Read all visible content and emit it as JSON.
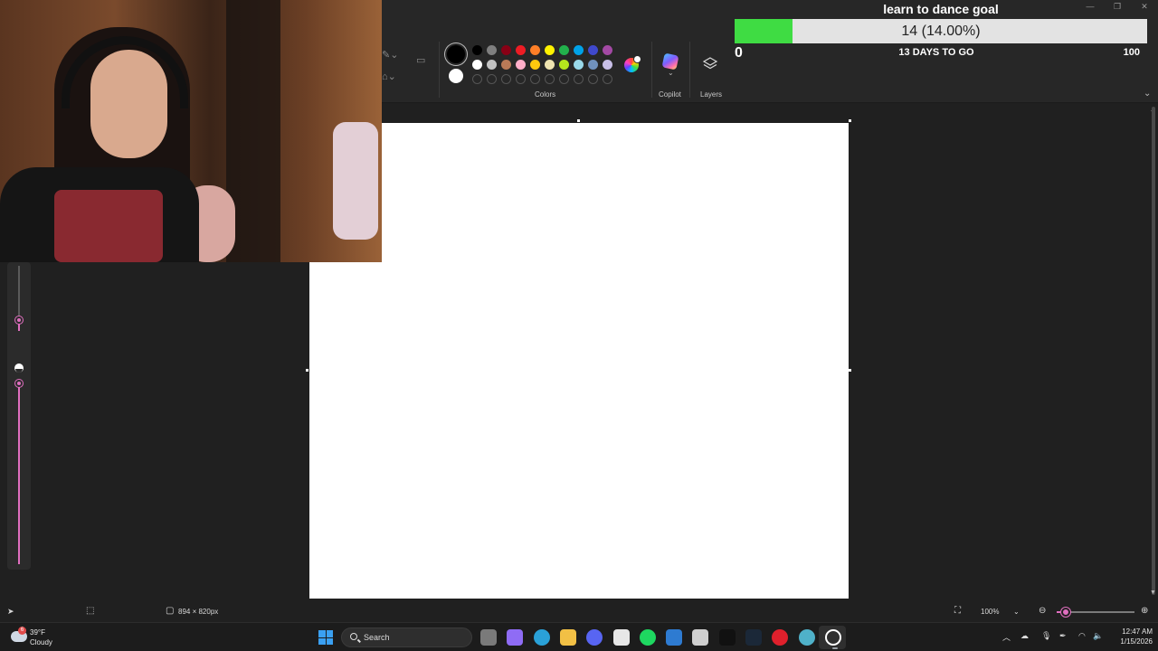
{
  "paint": {
    "ribbon": {
      "colors_label": "Colors",
      "copilot_label": "Copilot",
      "layers_label": "Layers",
      "primary_color": "#000000",
      "secondary_color": "#ffffff",
      "palette_row1": [
        "#000000",
        "#7f7f7f",
        "#880015",
        "#ed1c24",
        "#ff7f27",
        "#fff200",
        "#22b14c",
        "#00a2e8",
        "#3f48cc",
        "#a349a4"
      ],
      "palette_row2": [
        "#ffffff",
        "#c3c3c3",
        "#b97a57",
        "#ffaec9",
        "#ffc90e",
        "#efe4b0",
        "#b5e61d",
        "#99d9ea",
        "#7092be",
        "#c8bfe7"
      ],
      "custom_slots": 10
    },
    "status_bar": {
      "canvas_size": "894 × 820px",
      "zoom": "100%",
      "zoom_level": 0.12
    },
    "side_panel": {
      "size_level": 0.16,
      "opacity_level": 1.0
    },
    "accent_color": "#e06fbf"
  },
  "goal_overlay": {
    "title": "learn to dance goal",
    "progress_text": "14 (14.00%)",
    "progress_fraction": 0.14,
    "min_label": "0",
    "max_label": "100",
    "days_left": "13 DAYS TO GO",
    "bar_color": "#3fdc43"
  },
  "taskbar": {
    "weather_temp": "39°F",
    "weather_condition": "Cloudy",
    "weather_badge": "6",
    "search_label": "Search",
    "time": "12:47 AM",
    "date": "1/15/2026",
    "apps": [
      {
        "name": "task-view",
        "color": "#7a7a7a"
      },
      {
        "name": "copilot",
        "color": "#8f6cf5"
      },
      {
        "name": "edge",
        "color": "#2aa1d8"
      },
      {
        "name": "file-explorer",
        "color": "#f2c045"
      },
      {
        "name": "discord",
        "color": "#5865f2"
      },
      {
        "name": "microsoft-store",
        "color": "#e7e7e7"
      },
      {
        "name": "spotify",
        "color": "#1ed760"
      },
      {
        "name": "mail",
        "color": "#2e7bd1"
      },
      {
        "name": "camera-app",
        "color": "#cfcfcf"
      },
      {
        "name": "tiktok",
        "color": "#111111"
      },
      {
        "name": "steam",
        "color": "#1b2838"
      },
      {
        "name": "opera",
        "color": "#e0202c"
      },
      {
        "name": "browser-globe",
        "color": "#4fb1c9"
      },
      {
        "name": "obs-player",
        "color": "#ffffff"
      }
    ]
  }
}
